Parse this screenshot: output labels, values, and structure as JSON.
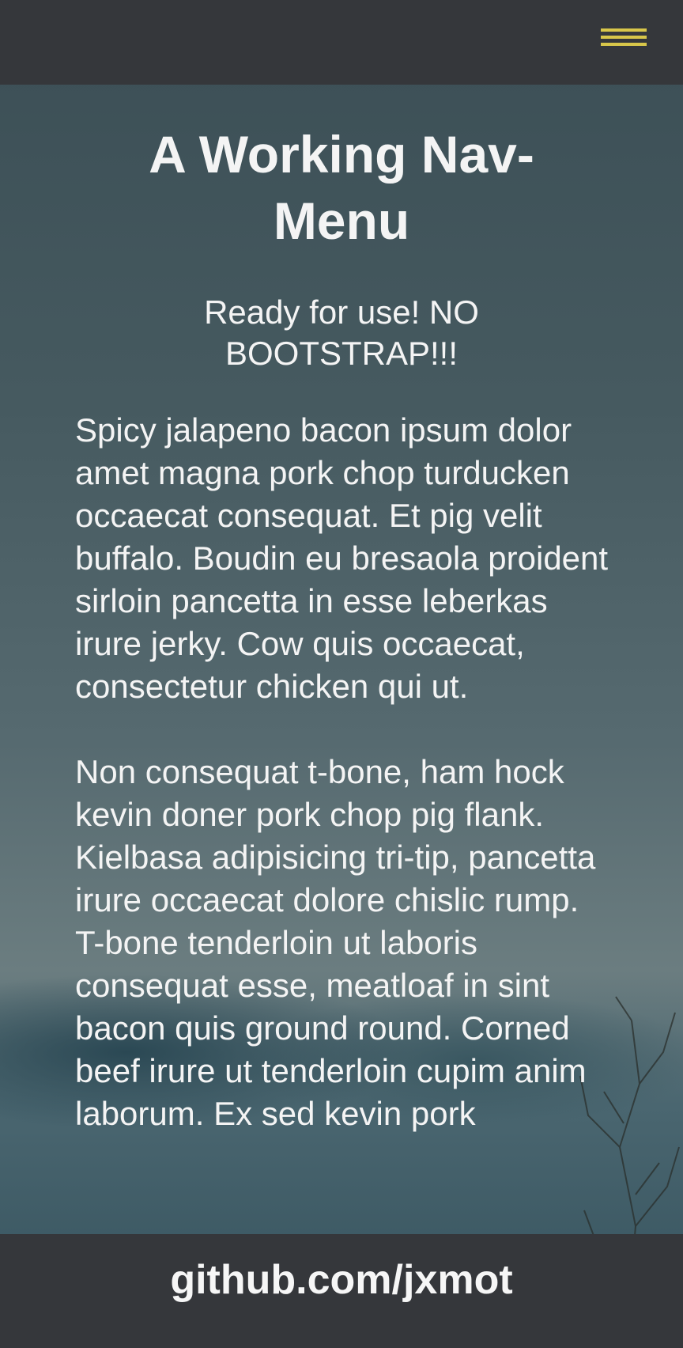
{
  "header": {
    "menu_icon": "hamburger-menu-icon",
    "menu_color": "#d8c64a"
  },
  "main": {
    "title": "A Working Nav-Menu",
    "subtitle": "Ready for use! NO BOOTSTRAP!!!",
    "paragraphs": [
      "Spicy jalapeno bacon ipsum dolor amet magna pork chop turducken occaecat consequat. Et pig velit buffalo. Boudin eu bresaola proident sirloin pancetta in esse leberkas irure jerky. Cow quis occaecat, consectetur chicken qui ut.",
      "Non consequat t-bone, ham hock kevin doner pork chop pig flank. Kielbasa adipisicing tri-tip, pancetta irure occaecat dolore chislic rump. T-bone tenderloin ut laboris consequat esse, meatloaf in sint bacon quis ground round. Corned beef irure ut tenderloin cupim anim laborum. Ex sed kevin pork"
    ]
  },
  "footer": {
    "link_text": "github.com/jxmot"
  },
  "colors": {
    "bar_background": "#35373b",
    "text": "#f4f4f4"
  }
}
